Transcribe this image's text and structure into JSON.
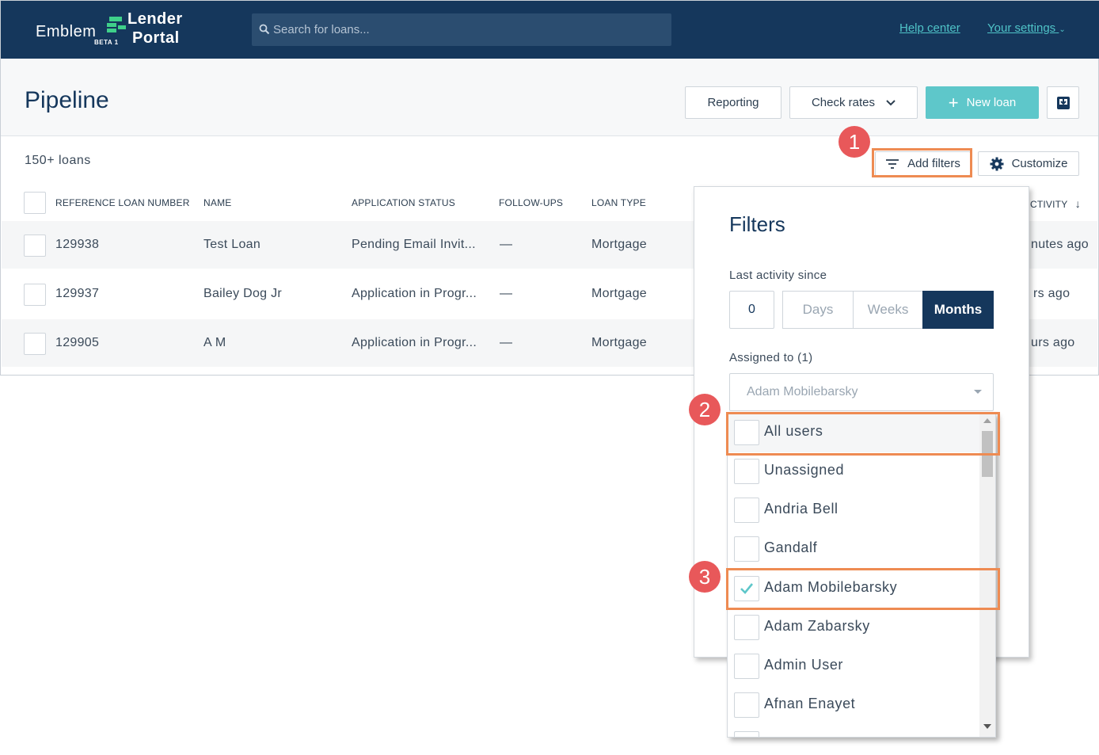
{
  "brand": {
    "emblem": "Emblem",
    "beta": "BETA 1",
    "lender": "Lender",
    "portal": "Portal"
  },
  "search": {
    "placeholder": "Search for loans..."
  },
  "nav": {
    "help_center": "Help center",
    "your_settings": "Your settings"
  },
  "header": {
    "title": "Pipeline",
    "reporting": "Reporting",
    "check_rates": "Check rates",
    "new_loan": "New loan"
  },
  "toolbar": {
    "loan_count": "150+ loans",
    "add_filters": "Add filters",
    "customize": "Customize"
  },
  "table": {
    "columns": [
      "REFERENCE LOAN NUMBER",
      "NAME",
      "APPLICATION STATUS",
      "FOLLOW-UPS",
      "LOAN TYPE",
      "CTIVITY"
    ],
    "rows": [
      {
        "ref": "129938",
        "name": "Test Loan",
        "status": "Pending Email Invit...",
        "followups": "—",
        "type": "Mortgage",
        "activity": "nutes ago"
      },
      {
        "ref": "129937",
        "name": "Bailey Dog Jr",
        "status": "Application in Progr...",
        "followups": "—",
        "type": "Mortgage",
        "activity": "rs ago"
      },
      {
        "ref": "129905",
        "name": "A M",
        "status": "Application in Progr...",
        "followups": "—",
        "type": "Mortgage",
        "activity": "urs ago"
      }
    ]
  },
  "filters": {
    "title": "Filters",
    "last_activity_label": "Last activity since",
    "last_activity_value": "0",
    "units": [
      "Days",
      "Weeks",
      "Months"
    ],
    "selected_unit": "Months",
    "assigned_label": "Assigned to (1)",
    "assigned_value": "Adam Mobilebarsky",
    "options": [
      {
        "label": "All users",
        "checked": false
      },
      {
        "label": "Unassigned",
        "checked": false
      },
      {
        "label": "Andria Bell",
        "checked": false
      },
      {
        "label": "Gandalf",
        "checked": false
      },
      {
        "label": "Adam Mobilebarsky",
        "checked": true
      },
      {
        "label": "Adam Zabarsky",
        "checked": false
      },
      {
        "label": "Admin User",
        "checked": false
      },
      {
        "label": "Afnan Enayet",
        "checked": false
      }
    ]
  },
  "annotations": [
    "1",
    "2",
    "3"
  ],
  "colors": {
    "navy": "#15375c",
    "teal": "#5ec7ca",
    "link": "#4fc3c7",
    "highlight": "#ee8b52",
    "badge": "#e8585a"
  }
}
